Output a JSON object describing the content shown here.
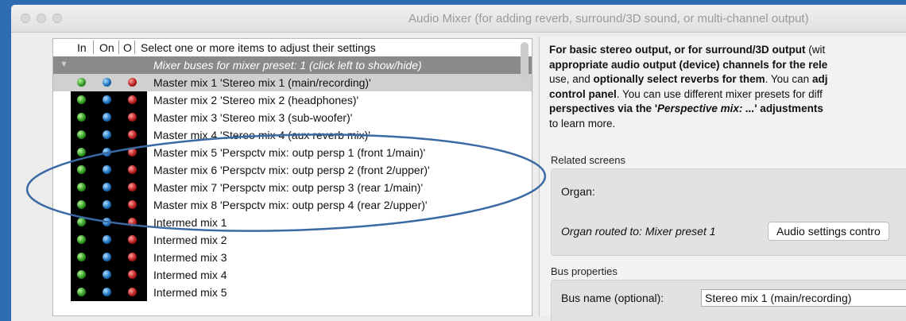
{
  "window": {
    "title": "Audio Mixer (for adding reverb, surround/3D sound, or multi-channel output)"
  },
  "list": {
    "header": {
      "in": "In",
      "on": "On",
      "o": "O",
      "instruction": "Select one or more items to adjust their settings"
    },
    "group_row": "Mixer buses for mixer preset: 1 (click left to show/hide)",
    "rows": [
      {
        "label": "Master mix 1 'Stereo mix 1 (main/recording)'",
        "selected": true
      },
      {
        "label": "Master mix 2 'Stereo mix 2 (headphones)'"
      },
      {
        "label": "Master mix 3 'Stereo mix 3 (sub-woofer)'"
      },
      {
        "label": "Master mix 4 'Stereo mix 4 (aux reverb mix)'"
      },
      {
        "label": "Master mix 5 'Perspctv mix: outp persp 1 (front 1/main)'"
      },
      {
        "label": "Master mix 6 'Perspctv mix: outp persp 2 (front 2/upper)'"
      },
      {
        "label": "Master mix 7 'Perspctv mix: outp persp 3 (rear 1/main)'"
      },
      {
        "label": "Master mix 8 'Perspctv mix: outp persp 4 (rear 2/upper)'"
      },
      {
        "label": "Intermed mix 1"
      },
      {
        "label": "Intermed mix 2"
      },
      {
        "label": "Intermed mix 3"
      },
      {
        "label": "Intermed mix 4"
      },
      {
        "label": "Intermed mix 5"
      }
    ]
  },
  "right": {
    "intro": {
      "line1_b": "For basic stereo output, or for surround/3D output",
      "line1_t": " (wit",
      "line2_b": "appropriate audio output (device) channels for the rele",
      "line3_t1": "use, and ",
      "line3_b": "optionally select reverbs for them",
      "line3_t2": ". You can ",
      "line3_b2": "adj",
      "line4_b": "control panel",
      "line4_t": ". You can use different mixer presets for diff",
      "line5_b1": "perspectives via the '",
      "line5_bi": "Perspective mix: ...",
      "line5_b2": "' adjustments",
      "line6_t": "to learn more."
    },
    "related_screens_label": "Related screens",
    "organ_label": "Organ:",
    "organ_routed": "Organ routed to: Mixer preset 1",
    "audio_settings_button": "Audio settings contro",
    "bus_properties_label": "Bus properties",
    "bus_name_label": "Bus name (optional):",
    "bus_name_value": "Stereo mix 1 (main/recording)"
  }
}
